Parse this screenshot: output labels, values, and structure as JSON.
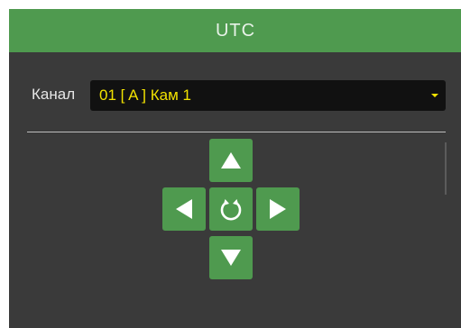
{
  "window": {
    "title": "UTC"
  },
  "channel": {
    "label": "Канал",
    "value": "01 [ A ] Кам 1"
  },
  "ptz": {
    "buttons": [
      {
        "name": "up",
        "icon": "arrow-up-icon"
      },
      {
        "name": "left",
        "icon": "arrow-left-icon"
      },
      {
        "name": "center",
        "icon": "refresh-icon"
      },
      {
        "name": "right",
        "icon": "arrow-right-icon"
      },
      {
        "name": "down",
        "icon": "arrow-down-icon"
      }
    ]
  },
  "colors": {
    "accent": "#4f9a4f",
    "background": "#3a3a3a",
    "select_bg": "#111111",
    "select_text": "#f2e200"
  }
}
